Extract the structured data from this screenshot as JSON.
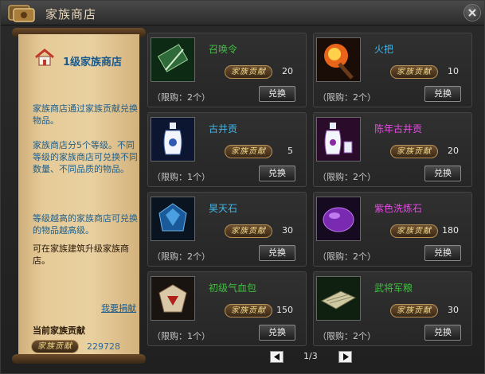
{
  "window": {
    "title": "家族商店"
  },
  "sidebar": {
    "heading": "1级家族商店",
    "para1": "家族商店通过家族贡献兑换物品。",
    "para2": "家族商店分5个等级。不同等级的家族商店可兑换不同数量、不同品质的物品。",
    "para3": "等级越高的家族商店可兑换的物品越高级。",
    "para4": "可在家族建筑升级家族商店。",
    "donate_link": "我要捐献",
    "balance_label": "当前家族贡献",
    "badge": "家族贡献",
    "balance_value": "229728"
  },
  "items": [
    {
      "name": "召唤令",
      "name_color": "#3fbf3f",
      "badge": "家族贡献",
      "cost": "20",
      "limit": "（限购：2个）",
      "button": "兑换",
      "icon": "summon-token-icon"
    },
    {
      "name": "火把",
      "name_color": "#3fb6ea",
      "badge": "家族贡献",
      "cost": "10",
      "limit": "（限购：2个）",
      "button": "兑换",
      "icon": "torch-icon"
    },
    {
      "name": "古井贡",
      "name_color": "#3fb6ea",
      "badge": "家族贡献",
      "cost": "5",
      "limit": "（限购：1个）",
      "button": "兑换",
      "icon": "wine-jar-icon"
    },
    {
      "name": "陈年古井贡",
      "name_color": "#e64ae6",
      "badge": "家族贡献",
      "cost": "20",
      "limit": "（限购：2个）",
      "button": "兑换",
      "icon": "aged-wine-icon"
    },
    {
      "name": "昊天石",
      "name_color": "#3fb6ea",
      "badge": "家族贡献",
      "cost": "30",
      "limit": "（限购：2个）",
      "button": "兑换",
      "icon": "blue-gem-icon"
    },
    {
      "name": "紫色洗炼石",
      "name_color": "#e64ae6",
      "badge": "家族贡献",
      "cost": "180",
      "limit": "（限购：2个）",
      "button": "兑换",
      "icon": "purple-gem-icon"
    },
    {
      "name": "初级气血包",
      "name_color": "#3fbf3f",
      "badge": "家族贡献",
      "cost": "150",
      "limit": "（限购：1个）",
      "button": "兑换",
      "icon": "health-pack-icon"
    },
    {
      "name": "武将军粮",
      "name_color": "#3fbf3f",
      "badge": "家族贡献",
      "cost": "30",
      "limit": "（限购：2个）",
      "button": "兑换",
      "icon": "army-ration-icon"
    }
  ],
  "pager": {
    "indicator": "1/3"
  }
}
